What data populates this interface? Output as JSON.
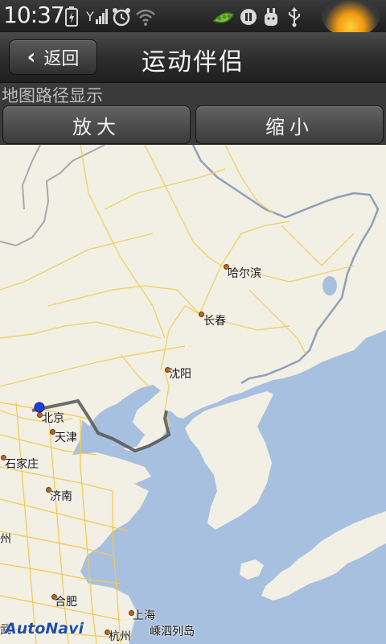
{
  "status_bar": {
    "time": "10:37",
    "icons": [
      "battery-icon",
      "signal-icon",
      "alarm-icon",
      "wifi-icon",
      "peapod-icon",
      "media-icon",
      "usb-debug-icon",
      "usb-icon"
    ]
  },
  "header": {
    "back_label": "返回",
    "title": "运动伴侣"
  },
  "map_section": {
    "label": "地图路径显示",
    "zoom_in_label": "放大",
    "zoom_out_label": "缩小"
  },
  "map": {
    "cities": {
      "harbin": "哈尔滨",
      "changchun": "长春",
      "shenyang": "沈阳",
      "beijing": "北京",
      "tianjin": "天津",
      "shijiazhuang": "石家庄",
      "jinan": "济南",
      "hefei": "合肥",
      "shanghai": "上海",
      "hangzhou": "杭州",
      "shengsi": "嵊泗列岛",
      "edge_zhou": "州",
      "edge_wu": "武"
    },
    "logo": "AutoNavi",
    "colors": {
      "land": "#f2efe4",
      "sea": "#a8c0df",
      "road": "#f6d96a",
      "route": "#555555"
    }
  }
}
